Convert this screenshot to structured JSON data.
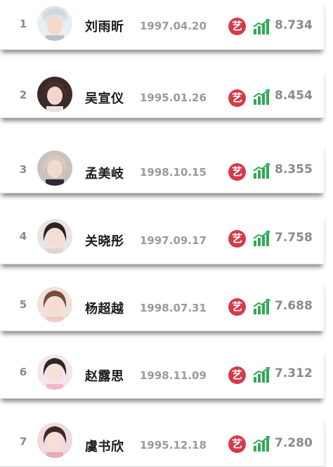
{
  "colors": {
    "badge_bg": "#d43a4a",
    "trend_green": "#2faa55",
    "rank_text": "#8a8a8a",
    "date_text": "#9a9a9a"
  },
  "icons": {
    "badge": "yi-badge-icon",
    "trend": "bar-chart-up-arrow-icon",
    "avatar": "avatar-photo"
  },
  "rows": [
    {
      "rank": "1",
      "name": "刘雨昕",
      "date": "1997.04.20",
      "badge": "艺",
      "score": "8.734"
    },
    {
      "rank": "2",
      "name": "吴宣仪",
      "date": "1995.01.26",
      "badge": "艺",
      "score": "8.454"
    },
    {
      "rank": "3",
      "name": "孟美岐",
      "date": "1998.10.15",
      "badge": "艺",
      "score": "8.355"
    },
    {
      "rank": "4",
      "name": "关晓彤",
      "date": "1997.09.17",
      "badge": "艺",
      "score": "7.758"
    },
    {
      "rank": "5",
      "name": "杨超越",
      "date": "1998.07.31",
      "badge": "艺",
      "score": "7.688"
    },
    {
      "rank": "6",
      "name": "赵露思",
      "date": "1998.11.09",
      "badge": "艺",
      "score": "7.312"
    },
    {
      "rank": "7",
      "name": "虞书欣",
      "date": "1995.12.18",
      "badge": "艺",
      "score": "7.280"
    }
  ]
}
